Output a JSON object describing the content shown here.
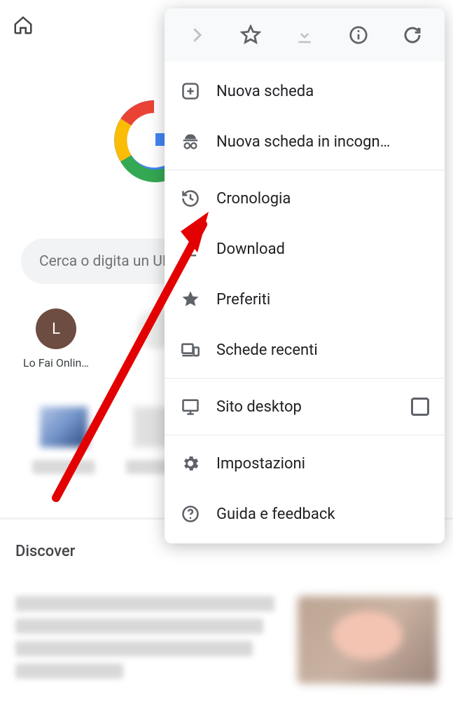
{
  "topbar": {},
  "search": {
    "placeholder": "Cerca o digita un URL"
  },
  "shortcuts": [
    {
      "initial": "L",
      "label": "Lo Fai Onlin…",
      "bg": "#6d4c41"
    }
  ],
  "discover": {
    "title": "Discover"
  },
  "menu": {
    "top_actions": [
      "forward",
      "star",
      "download",
      "info",
      "reload"
    ],
    "items": [
      {
        "icon": "plus",
        "label": "Nuova scheda"
      },
      {
        "icon": "incognito",
        "label": "Nuova scheda in incogn…"
      },
      {
        "sep": true
      },
      {
        "icon": "history",
        "label": "Cronologia"
      },
      {
        "icon": "download",
        "label": "Download"
      },
      {
        "icon": "star-filled",
        "label": "Preferiti"
      },
      {
        "icon": "devices",
        "label": "Schede recenti"
      },
      {
        "sep": true
      },
      {
        "icon": "desktop",
        "label": "Sito desktop",
        "checkbox": true
      },
      {
        "sep": true
      },
      {
        "icon": "gear",
        "label": "Impostazioni"
      },
      {
        "icon": "help",
        "label": "Guida e feedback"
      }
    ]
  }
}
